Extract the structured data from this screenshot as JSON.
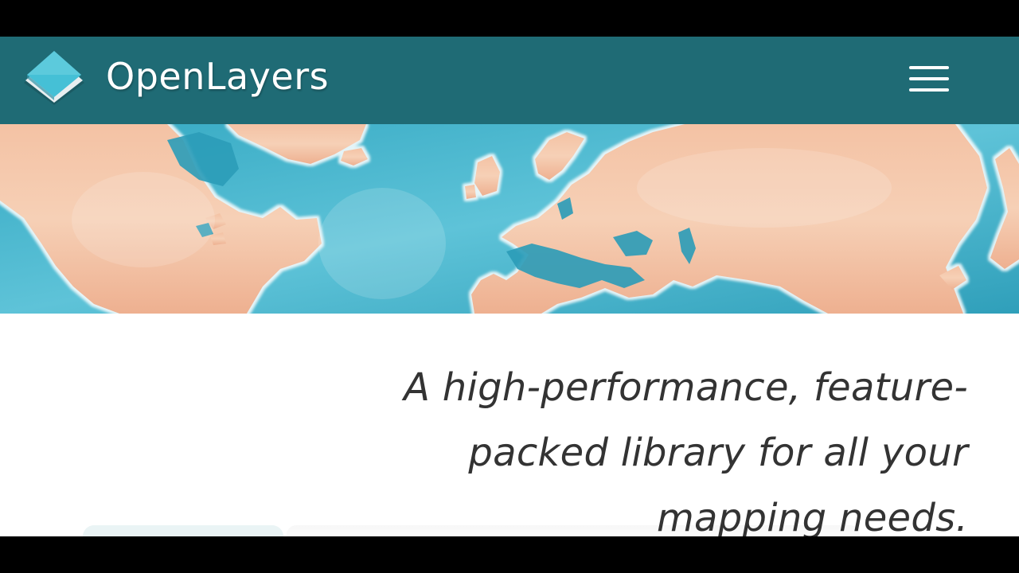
{
  "header": {
    "brand": "OpenLayers",
    "logo_icon": "openlayers-logo-icon",
    "menu_icon": "hamburger-menu-icon"
  },
  "banner": {
    "image": "watercolor-world-map"
  },
  "hero": {
    "tagline": "A high-performance, feature-packed library for all your mapping needs."
  },
  "colors": {
    "navbar": "#1f6b75",
    "brand_text": "#ffffff",
    "tagline_text": "#333333",
    "ocean": "#3fb0c8",
    "land": "#f0b99a",
    "letterbox": "#000000"
  }
}
